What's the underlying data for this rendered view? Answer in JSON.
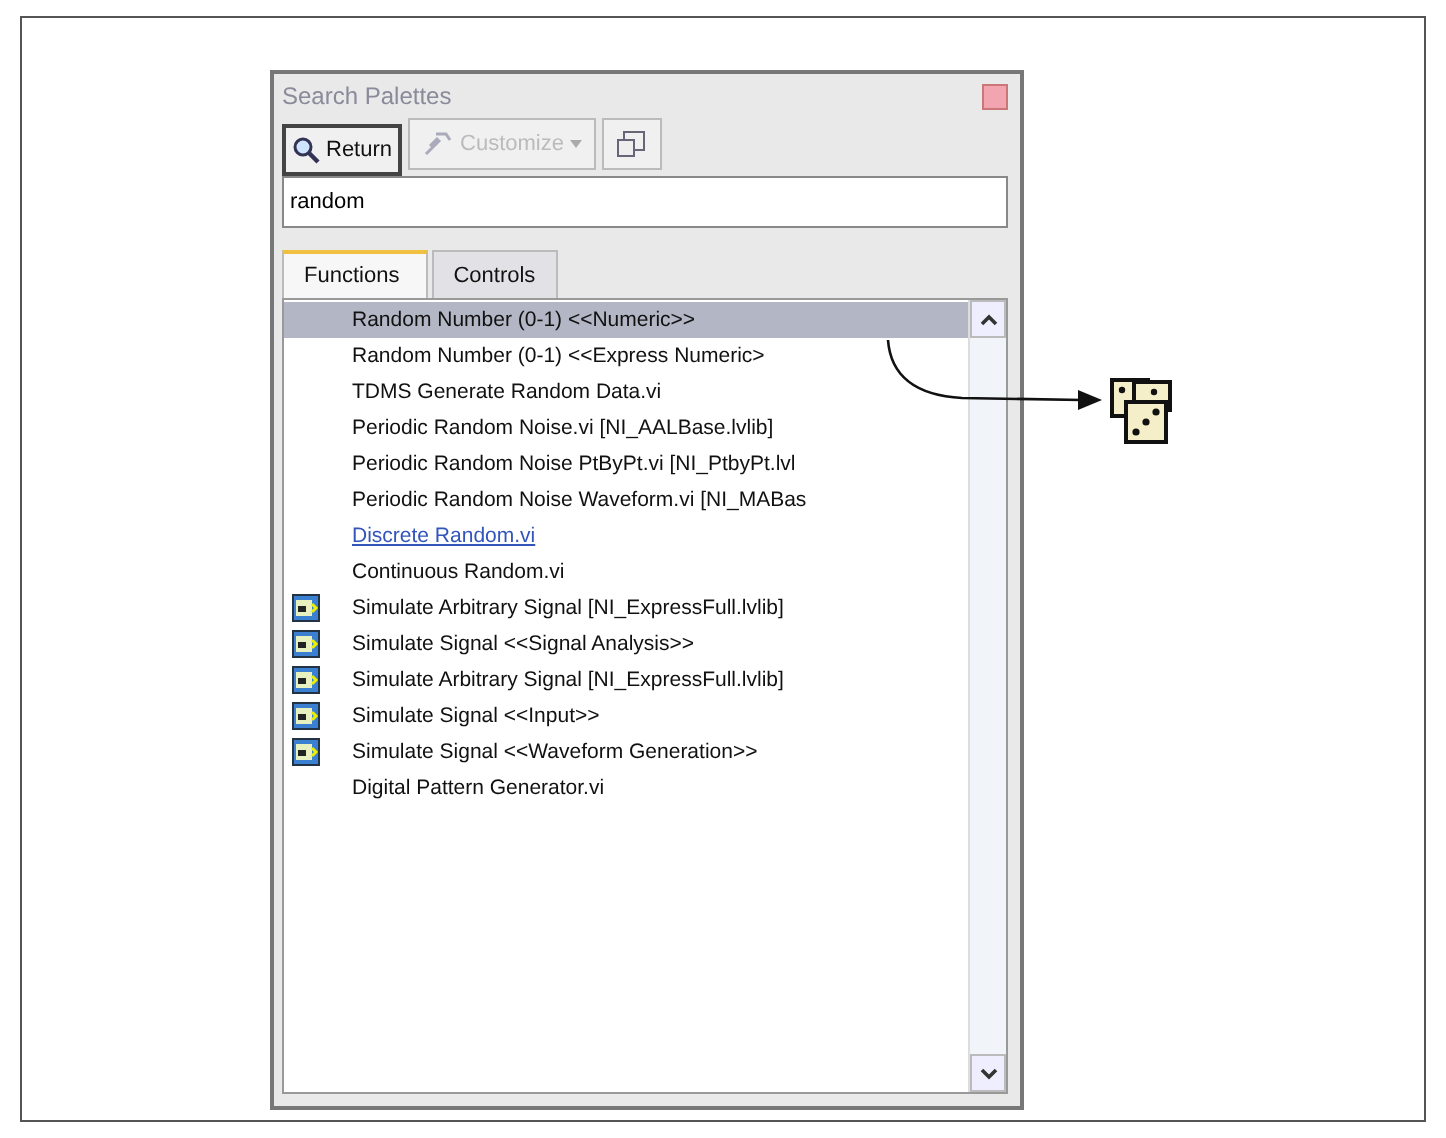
{
  "window": {
    "title": "Search Palettes"
  },
  "toolbar": [
    {
      "label": "Return",
      "kind": "search",
      "disabled": false
    },
    {
      "label": "Customize",
      "kind": "dropdown",
      "disabled": true
    },
    {
      "kind": "window",
      "disabled": false
    }
  ],
  "search": {
    "value": "random"
  },
  "tabs": [
    {
      "label": "Functions",
      "selected": true
    },
    {
      "label": "Controls",
      "selected": false
    }
  ],
  "results": [
    {
      "label": "Random Number (0-1)   <<Numeric>>",
      "kind": "plain",
      "selected": true
    },
    {
      "label": "Random Number (0-1)   <<Express Numeric>",
      "kind": "plain",
      "selected": false
    },
    {
      "label": "TDMS Generate Random Data.vi",
      "kind": "plain",
      "selected": false
    },
    {
      "label": "Periodic Random Noise.vi [NI_AALBase.lvlib]",
      "kind": "plain",
      "selected": false
    },
    {
      "label": "Periodic Random Noise PtByPt.vi [NI_PtbyPt.lvl",
      "kind": "plain",
      "selected": false
    },
    {
      "label": "Periodic Random Noise Waveform.vi [NI_MABas",
      "kind": "plain",
      "selected": false
    },
    {
      "label": "Discrete Random.vi",
      "kind": "link",
      "selected": false
    },
    {
      "label": "Continuous Random.vi",
      "kind": "plain",
      "selected": false
    },
    {
      "label": "Simulate Arbitrary Signal [NI_ExpressFull.lvlib]",
      "kind": "express",
      "selected": false
    },
    {
      "label": "Simulate Signal   <<Signal Analysis>>",
      "kind": "express",
      "selected": false
    },
    {
      "label": "Simulate Arbitrary Signal [NI_ExpressFull.lvlib]",
      "kind": "express",
      "selected": false
    },
    {
      "label": "Simulate Signal   <<Input>>",
      "kind": "express",
      "selected": false
    },
    {
      "label": "Simulate Signal   <<Waveform Generation>>",
      "kind": "express",
      "selected": false
    },
    {
      "label": "Digital Pattern Generator.vi",
      "kind": "plain",
      "selected": false
    }
  ]
}
